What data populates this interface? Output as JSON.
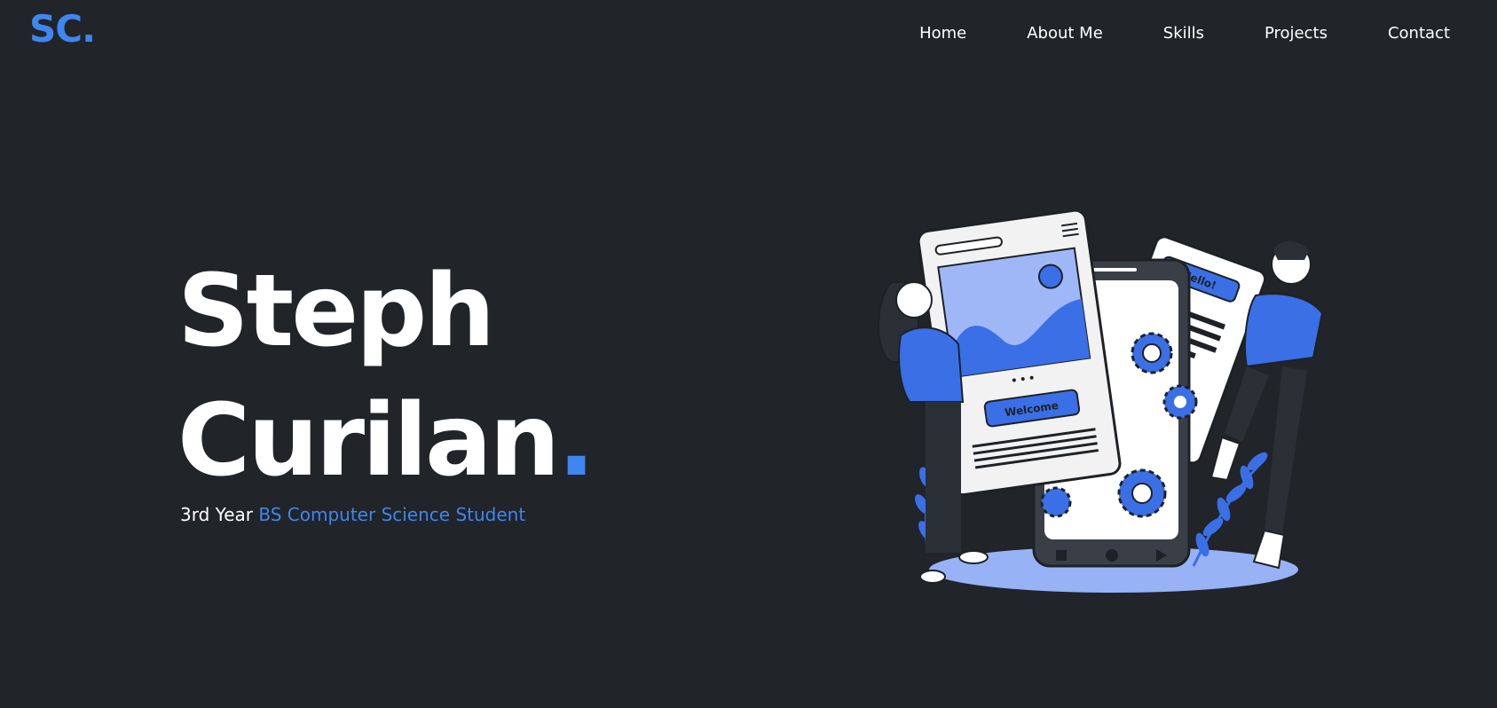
{
  "header": {
    "logo_text": "SC",
    "logo_dot": "."
  },
  "nav": {
    "items": [
      {
        "label": "Home"
      },
      {
        "label": "About Me"
      },
      {
        "label": "Skills"
      },
      {
        "label": "Projects"
      },
      {
        "label": "Contact"
      }
    ]
  },
  "hero": {
    "first_name": "Steph",
    "last_name": "Curilan",
    "name_dot": ".",
    "subtitle_prefix": "3rd Year ",
    "subtitle_highlight": "BS Computer Science Student"
  },
  "illustration": {
    "welcome_label": "Welcome",
    "hello_label": "Hello!"
  },
  "colors": {
    "background": "#212429",
    "accent": "#3f86f0",
    "text": "#ffffff"
  }
}
